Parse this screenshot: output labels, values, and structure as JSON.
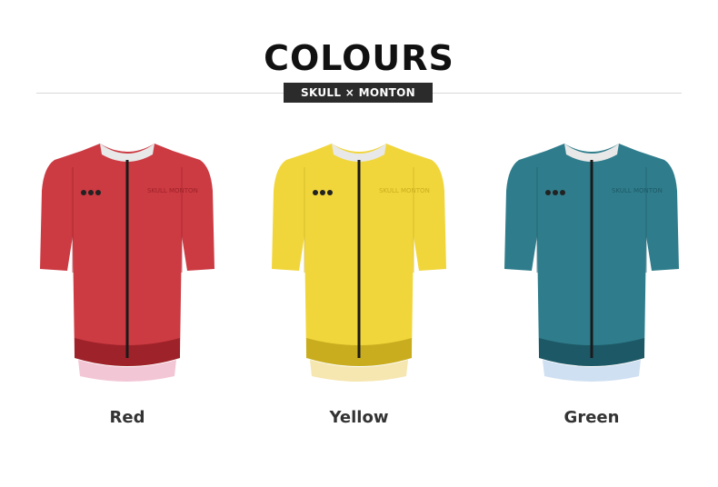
{
  "header": {
    "title": "COLOURS",
    "subtitle": "SKULL × MONTON"
  },
  "products": [
    {
      "label": "Red",
      "color": "#cc3a42",
      "shade": "#9e2229",
      "hem": "#f3c6d6",
      "logo": "SKULL MONTON"
    },
    {
      "label": "Yellow",
      "color": "#f1d63b",
      "shade": "#c9ad1f",
      "hem": "#f6e6b0",
      "logo": "SKULL MONTON"
    },
    {
      "label": "Green",
      "color": "#2f7d8c",
      "shade": "#1d5866",
      "hem": "#cfe0f2",
      "logo": "SKULL MONTON"
    }
  ]
}
